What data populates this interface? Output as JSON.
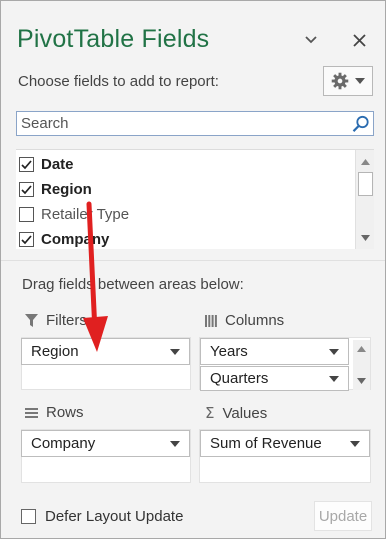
{
  "title": "PivotTable Fields",
  "choose_label": "Choose fields to add to report:",
  "search": {
    "placeholder": "Search"
  },
  "fields": [
    {
      "label": "Date",
      "checked": true
    },
    {
      "label": "Region",
      "checked": true
    },
    {
      "label": "Retailer Type",
      "checked": false
    },
    {
      "label": "Company",
      "checked": true
    }
  ],
  "drag_label": "Drag fields between areas below:",
  "areas": {
    "filters": {
      "label": "Filters",
      "items": [
        "Region"
      ]
    },
    "columns": {
      "label": "Columns",
      "items": [
        "Years",
        "Quarters"
      ]
    },
    "rows": {
      "label": "Rows",
      "items": [
        "Company"
      ]
    },
    "values": {
      "label": "Values",
      "items": [
        "Sum of Revenue"
      ]
    }
  },
  "defer_label": "Defer Layout Update",
  "update_label": "Update",
  "colors": {
    "title": "#217346",
    "annotation_arrow": "#e02020"
  },
  "icons": [
    "chevron-down-icon",
    "close-icon",
    "gear-icon",
    "search-icon",
    "filter-icon",
    "columns-icon",
    "rows-icon",
    "sigma-icon",
    "checkmark-icon"
  ]
}
